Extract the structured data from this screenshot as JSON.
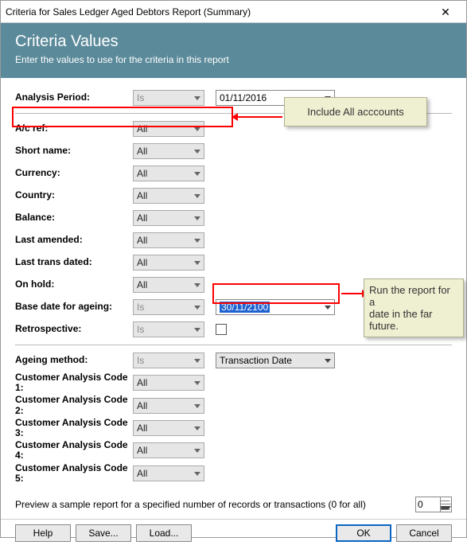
{
  "window": {
    "title": "Criteria for Sales Ledger Aged Debtors Report (Summary)"
  },
  "header": {
    "title": "Criteria Values",
    "subtitle": "Enter the values to use for the criteria in this report"
  },
  "rows": {
    "analysis_period": {
      "label": "Analysis Period:",
      "op": "Is",
      "val": "01/11/2016"
    },
    "ac_ref": {
      "label": "A/c ref:",
      "op": "All"
    },
    "short_name": {
      "label": "Short name:",
      "op": "All"
    },
    "currency": {
      "label": "Currency:",
      "op": "All"
    },
    "country": {
      "label": "Country:",
      "op": "All"
    },
    "balance": {
      "label": "Balance:",
      "op": "All"
    },
    "last_amended": {
      "label": "Last amended:",
      "op": "All"
    },
    "last_trans": {
      "label": "Last trans dated:",
      "op": "All"
    },
    "on_hold": {
      "label": "On hold:",
      "op": "All"
    },
    "base_date": {
      "label": "Base date for ageing:",
      "op": "Is",
      "val": "30/11/2100"
    },
    "retrospective": {
      "label": "Retrospective:",
      "op": "Is"
    },
    "ageing_method": {
      "label": "Ageing method:",
      "op": "Is",
      "val": "Transaction Date"
    },
    "cac1": {
      "label": "Customer Analysis Code 1:",
      "op": "All"
    },
    "cac2": {
      "label": "Customer Analysis Code 2:",
      "op": "All"
    },
    "cac3": {
      "label": "Customer Analysis Code 3:",
      "op": "All"
    },
    "cac4": {
      "label": "Customer Analysis Code 4:",
      "op": "All"
    },
    "cac5": {
      "label": "Customer Analysis Code 5:",
      "op": "All"
    }
  },
  "preview": {
    "text": "Preview a sample report for a specified number of records or transactions (0 for all)",
    "value": "0"
  },
  "buttons": {
    "help": "Help",
    "save": "Save...",
    "load": "Load...",
    "ok": "OK",
    "cancel": "Cancel"
  },
  "annotations": {
    "include_all": "Include  All acccounts",
    "far_future_l1": "Run the report for a",
    "far_future_l2": "date in the far future."
  }
}
